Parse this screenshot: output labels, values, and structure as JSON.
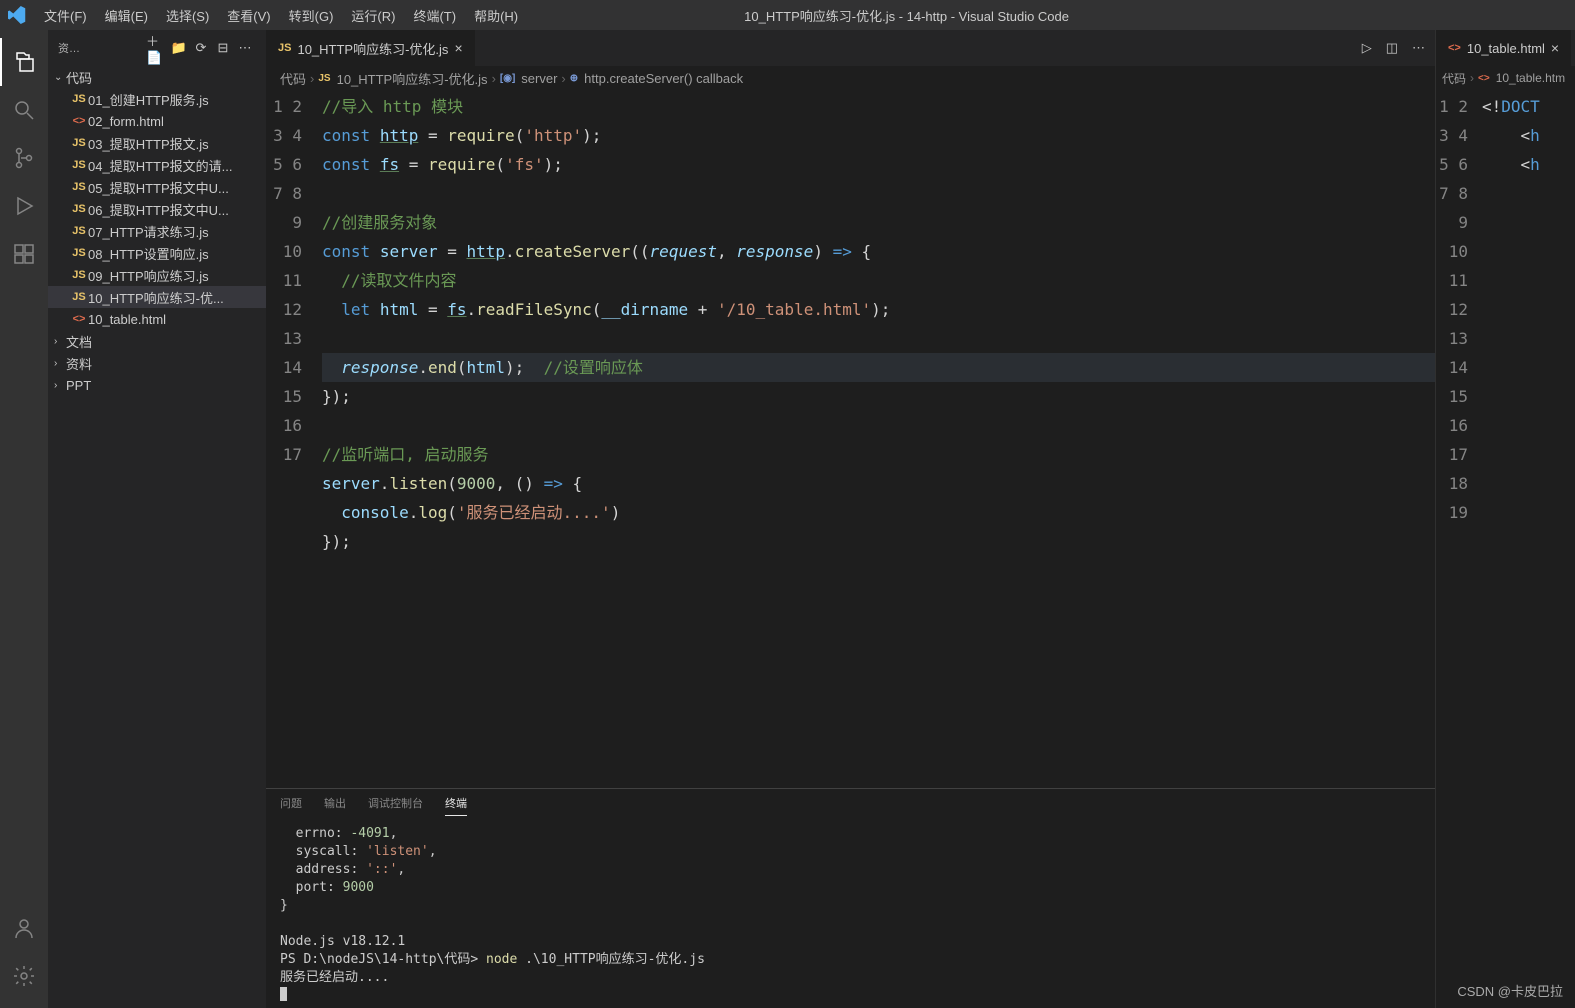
{
  "titlebar": {
    "menu": [
      "文件(F)",
      "编辑(E)",
      "选择(S)",
      "查看(V)",
      "转到(G)",
      "运行(R)",
      "终端(T)",
      "帮助(H)"
    ],
    "title": "10_HTTP响应练习-优化.js - 14-http - Visual Studio Code"
  },
  "sidebar": {
    "header_label": "资…",
    "root": "代码",
    "files": [
      {
        "icon": "JS",
        "cls": "js",
        "name": "01_创建HTTP服务.js"
      },
      {
        "icon": "<>",
        "cls": "html",
        "name": "02_form.html"
      },
      {
        "icon": "JS",
        "cls": "js",
        "name": "03_提取HTTP报文.js"
      },
      {
        "icon": "JS",
        "cls": "js",
        "name": "04_提取HTTP报文的请..."
      },
      {
        "icon": "JS",
        "cls": "js",
        "name": "05_提取HTTP报文中U..."
      },
      {
        "icon": "JS",
        "cls": "js",
        "name": "06_提取HTTP报文中U..."
      },
      {
        "icon": "JS",
        "cls": "js",
        "name": "07_HTTP请求练习.js"
      },
      {
        "icon": "JS",
        "cls": "js",
        "name": "08_HTTP设置响应.js"
      },
      {
        "icon": "JS",
        "cls": "js",
        "name": "09_HTTP响应练习.js"
      },
      {
        "icon": "JS",
        "cls": "js",
        "name": "10_HTTP响应练习-优..."
      },
      {
        "icon": "<>",
        "cls": "html",
        "name": "10_table.html"
      }
    ],
    "folders": [
      "文档",
      "资料",
      "PPT"
    ]
  },
  "editor": {
    "tab_label": "10_HTTP响应练习-优化.js",
    "breadcrumb": {
      "parts": [
        "代码",
        "10_HTTP响应练习-优化.js",
        "server",
        "http.createServer() callback"
      ]
    },
    "code": {
      "comment1": "//导入 http 模块",
      "const": "const",
      "httpVar": "http",
      "eq": " = ",
      "require": "require",
      "httpStr": "'http'",
      "fsVar": "fs",
      "fsStr": "'fs'",
      "comment2": "//创建服务对象",
      "serverVar": "server",
      "createServer": "createServer",
      "request": "request",
      "response": "response",
      "arrow": " => ",
      "comment3": "//读取文件内容",
      "let": "let",
      "htmlVar": "html",
      "readFileSync": "readFileSync",
      "dirname": "__dirname",
      "plus": " + ",
      "pathStr": "'/10_table.html'",
      "end": "end",
      "comment4": "//设置响应体",
      "comment5": "//监听端口, 启动服务",
      "listen": "listen",
      "port": "9000",
      "console": "console",
      "log": "log",
      "logStr": "'服务已经启动....'"
    }
  },
  "rightPanel": {
    "tab_label": "10_table.html",
    "breadcrumb": [
      "代码",
      "10_table.htm"
    ],
    "doctype": "<!DOCT",
    "tagOpen": "<h"
  },
  "panel": {
    "tabs": [
      "问题",
      "输出",
      "调试控制台",
      "终端"
    ],
    "terminal": "  errno: -4091,\n  syscall: 'listen',\n  address: '::',\n  port: 9000\n}\n\nNode.js v18.12.1\nPS D:\\nodeJS\\14-http\\代码> node .\\10_HTTP响应练习-优化.js\n服务已经启动...."
  },
  "watermark": "CSDN @卡皮巴拉"
}
